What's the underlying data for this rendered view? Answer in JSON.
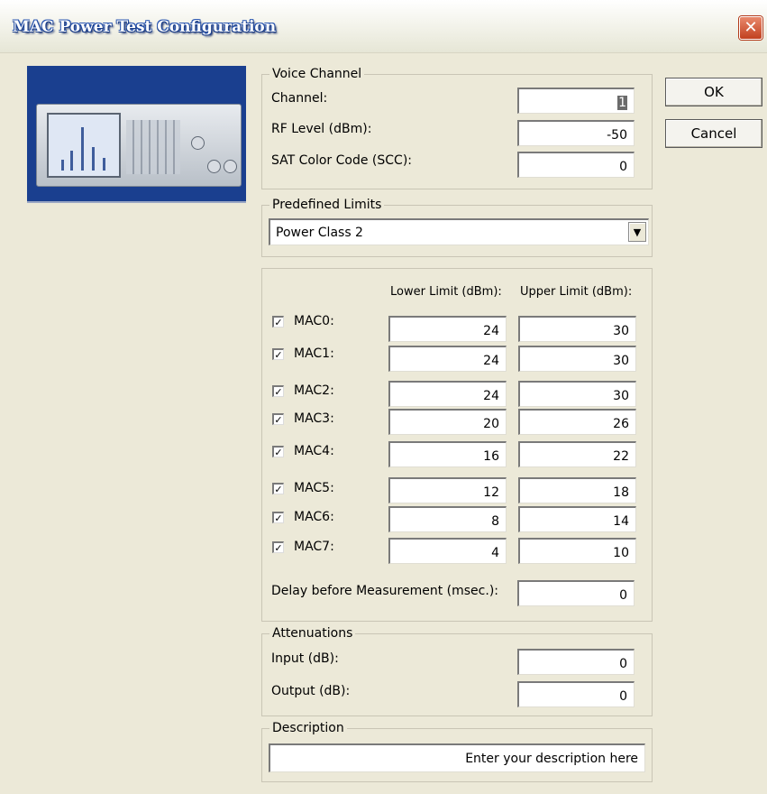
{
  "window": {
    "title": "MAC Power Test Configuration",
    "close_icon": "close-icon"
  },
  "buttons": {
    "ok": "OK",
    "cancel": "Cancel"
  },
  "voice_channel": {
    "legend": "Voice Channel",
    "channel_label": "Channel:",
    "channel_value": "1",
    "rf_label": "RF Level (dBm):",
    "rf_value": "-50",
    "sat_label": "SAT Color Code (SCC):",
    "sat_value": "0"
  },
  "predefined_limits": {
    "legend": "Predefined Limits",
    "selected": "Power Class 2"
  },
  "limits": {
    "lower_header": "Lower Limit (dBm):",
    "upper_header": "Upper Limit (dBm):",
    "rows": [
      {
        "label": "MAC0:",
        "checked": true,
        "lower": "24",
        "upper": "30"
      },
      {
        "label": "MAC1:",
        "checked": true,
        "lower": "24",
        "upper": "30"
      },
      {
        "label": "MAC2:",
        "checked": true,
        "lower": "24",
        "upper": "30"
      },
      {
        "label": "MAC3:",
        "checked": true,
        "lower": "20",
        "upper": "26"
      },
      {
        "label": "MAC4:",
        "checked": true,
        "lower": "16",
        "upper": "22"
      },
      {
        "label": "MAC5:",
        "checked": true,
        "lower": "12",
        "upper": "18"
      },
      {
        "label": "MAC6:",
        "checked": true,
        "lower": "8",
        "upper": "14"
      },
      {
        "label": "MAC7:",
        "checked": true,
        "lower": "4",
        "upper": "10"
      }
    ],
    "delay_label": "Delay before Measurement (msec.):",
    "delay_value": "0"
  },
  "attenuations": {
    "legend": "Attenuations",
    "input_label": "Input (dB):",
    "input_value": "0",
    "output_label": "Output (dB):",
    "output_value": "0"
  },
  "description": {
    "legend": "Description",
    "value": "Enter your description here"
  }
}
